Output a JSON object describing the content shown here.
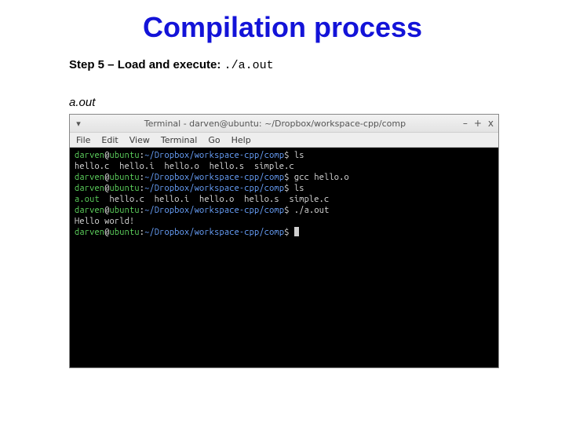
{
  "slide": {
    "title": "Compilation process",
    "step_label_bold": "Step 5 – Load and execute: ",
    "step_label_mono": "./a.out",
    "caption": "a.out"
  },
  "window": {
    "title": "Terminal - darven@ubuntu: ~/Dropbox/workspace-cpp/comp",
    "menu": [
      "File",
      "Edit",
      "View",
      "Terminal",
      "Go",
      "Help"
    ],
    "btn_min": "–",
    "btn_max": "+",
    "btn_close": "x",
    "dropdown": "▾"
  },
  "prompt": {
    "user": "darven",
    "at": "@",
    "host": "ubuntu",
    "colon": ":",
    "path": "~/Dropbox/workspace-cpp/comp",
    "dollar": "$"
  },
  "lines": {
    "cmd1": " ls",
    "ls1": "hello.c  hello.i  hello.o  hello.s  simple.c",
    "cmd2": " gcc hello.o",
    "cmd3": " ls",
    "ls2_exe": "a.out",
    "ls2_rest": "  hello.c  hello.i  hello.o  hello.s  simple.c",
    "cmd4": " ./a.out",
    "output": "Hello world!",
    "cmd5": " "
  }
}
